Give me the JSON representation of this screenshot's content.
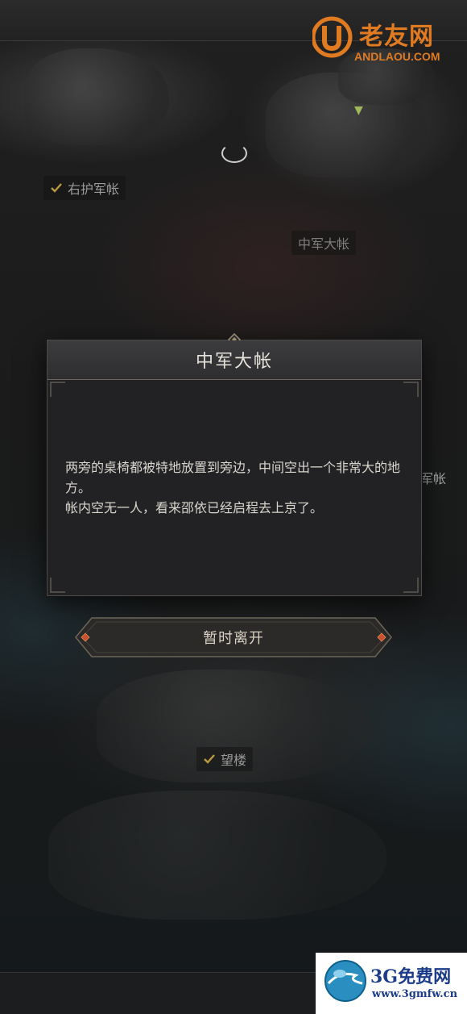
{
  "map": {
    "labels": {
      "right_guard_tent": "右护军帐",
      "central_tent": "中军大帐",
      "watchtower": "望楼",
      "side_partial": "军帐"
    }
  },
  "dialog": {
    "title": "中军大帐",
    "body_lines": [
      "两旁的桌椅都被特地放置到旁边，中间空出一个非常大的地方。",
      "帐内空无一人，看来邵依已经启程去上京了。"
    ]
  },
  "buttons": {
    "leave": "暂时离开"
  },
  "watermarks": {
    "top_cn": "老友网",
    "top_en": "ANDLAOU.COM",
    "bottom_cn": "3G免费网",
    "bottom_en": "www.3gmfw.cn"
  },
  "colors": {
    "check": "#b99a3e",
    "accent_gem": "#c8502a",
    "watermark_orange": "#e07b22",
    "watermark_blue": "#1c3c8a"
  },
  "icons": [
    "check-icon",
    "diamond-gem-icon",
    "location-pin-icon",
    "ring-marker-icon"
  ]
}
